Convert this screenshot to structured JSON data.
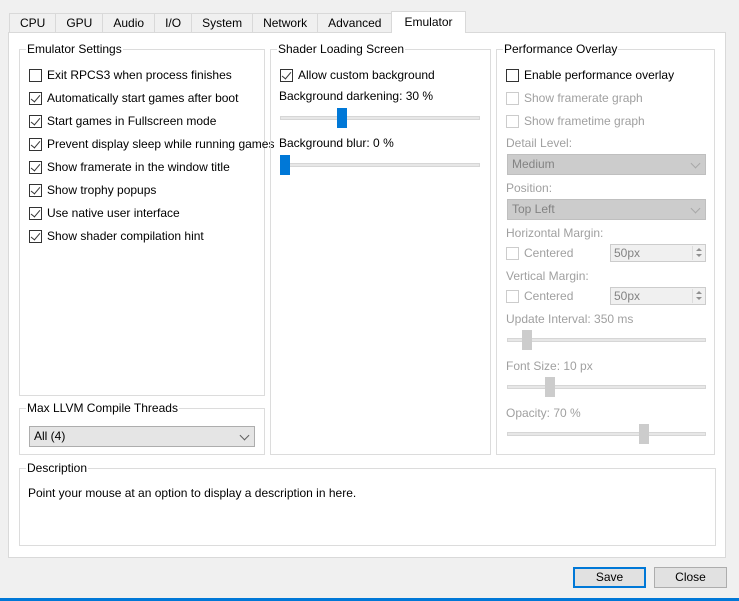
{
  "tabs": [
    {
      "label": "CPU",
      "active": false
    },
    {
      "label": "GPU",
      "active": false
    },
    {
      "label": "Audio",
      "active": false
    },
    {
      "label": "I/O",
      "active": false
    },
    {
      "label": "System",
      "active": false
    },
    {
      "label": "Network",
      "active": false
    },
    {
      "label": "Advanced",
      "active": false
    },
    {
      "label": "Emulator",
      "active": true
    }
  ],
  "emulator_settings": {
    "title": "Emulator Settings",
    "options": [
      {
        "label": "Exit RPCS3 when process finishes",
        "checked": false
      },
      {
        "label": "Automatically start games after boot",
        "checked": true
      },
      {
        "label": "Start games in Fullscreen mode",
        "checked": true
      },
      {
        "label": "Prevent display sleep while running games",
        "checked": true
      },
      {
        "label": "Show framerate in the window title",
        "checked": true
      },
      {
        "label": "Show trophy popups",
        "checked": true
      },
      {
        "label": "Use native user interface",
        "checked": true
      },
      {
        "label": "Show shader compilation hint",
        "checked": true
      }
    ]
  },
  "llvm_threads": {
    "title": "Max LLVM Compile Threads",
    "selected": "All (4)"
  },
  "shader_loading": {
    "title": "Shader Loading Screen",
    "allow_custom_background": {
      "label": "Allow custom background",
      "checked": true
    },
    "darkening": {
      "label": "Background darkening: 30 %",
      "value_percent": 30
    },
    "blur": {
      "label": "Background blur: 0 %",
      "value_percent": 0
    }
  },
  "performance_overlay": {
    "title": "Performance Overlay",
    "enable": {
      "label": "Enable performance overlay",
      "checked": false
    },
    "framerate_graph": {
      "label": "Show framerate graph",
      "checked": false
    },
    "frametime_graph": {
      "label": "Show frametime graph",
      "checked": false
    },
    "detail_level": {
      "label": "Detail Level:",
      "selected": "Medium"
    },
    "position": {
      "label": "Position:",
      "selected": "Top Left"
    },
    "horizontal_margin": {
      "label": "Horizontal Margin:",
      "centered_label": "Centered",
      "centered": false,
      "value": "50px"
    },
    "vertical_margin": {
      "label": "Vertical Margin:",
      "centered_label": "Centered",
      "centered": false,
      "value": "50px"
    },
    "update_interval": {
      "label": "Update Interval: 350 ms",
      "value_fraction": 0.08
    },
    "font_size": {
      "label": "Font Size: 10 px",
      "value_fraction": 0.2
    },
    "opacity": {
      "label": "Opacity: 70 %",
      "value_fraction": 0.7
    }
  },
  "description": {
    "title": "Description",
    "text": "Point your mouse at an option to display a description in here."
  },
  "buttons": {
    "save": "Save",
    "close": "Close"
  },
  "colors": {
    "accent": "#0078d7",
    "disabled_thumb": "#cccccc"
  }
}
